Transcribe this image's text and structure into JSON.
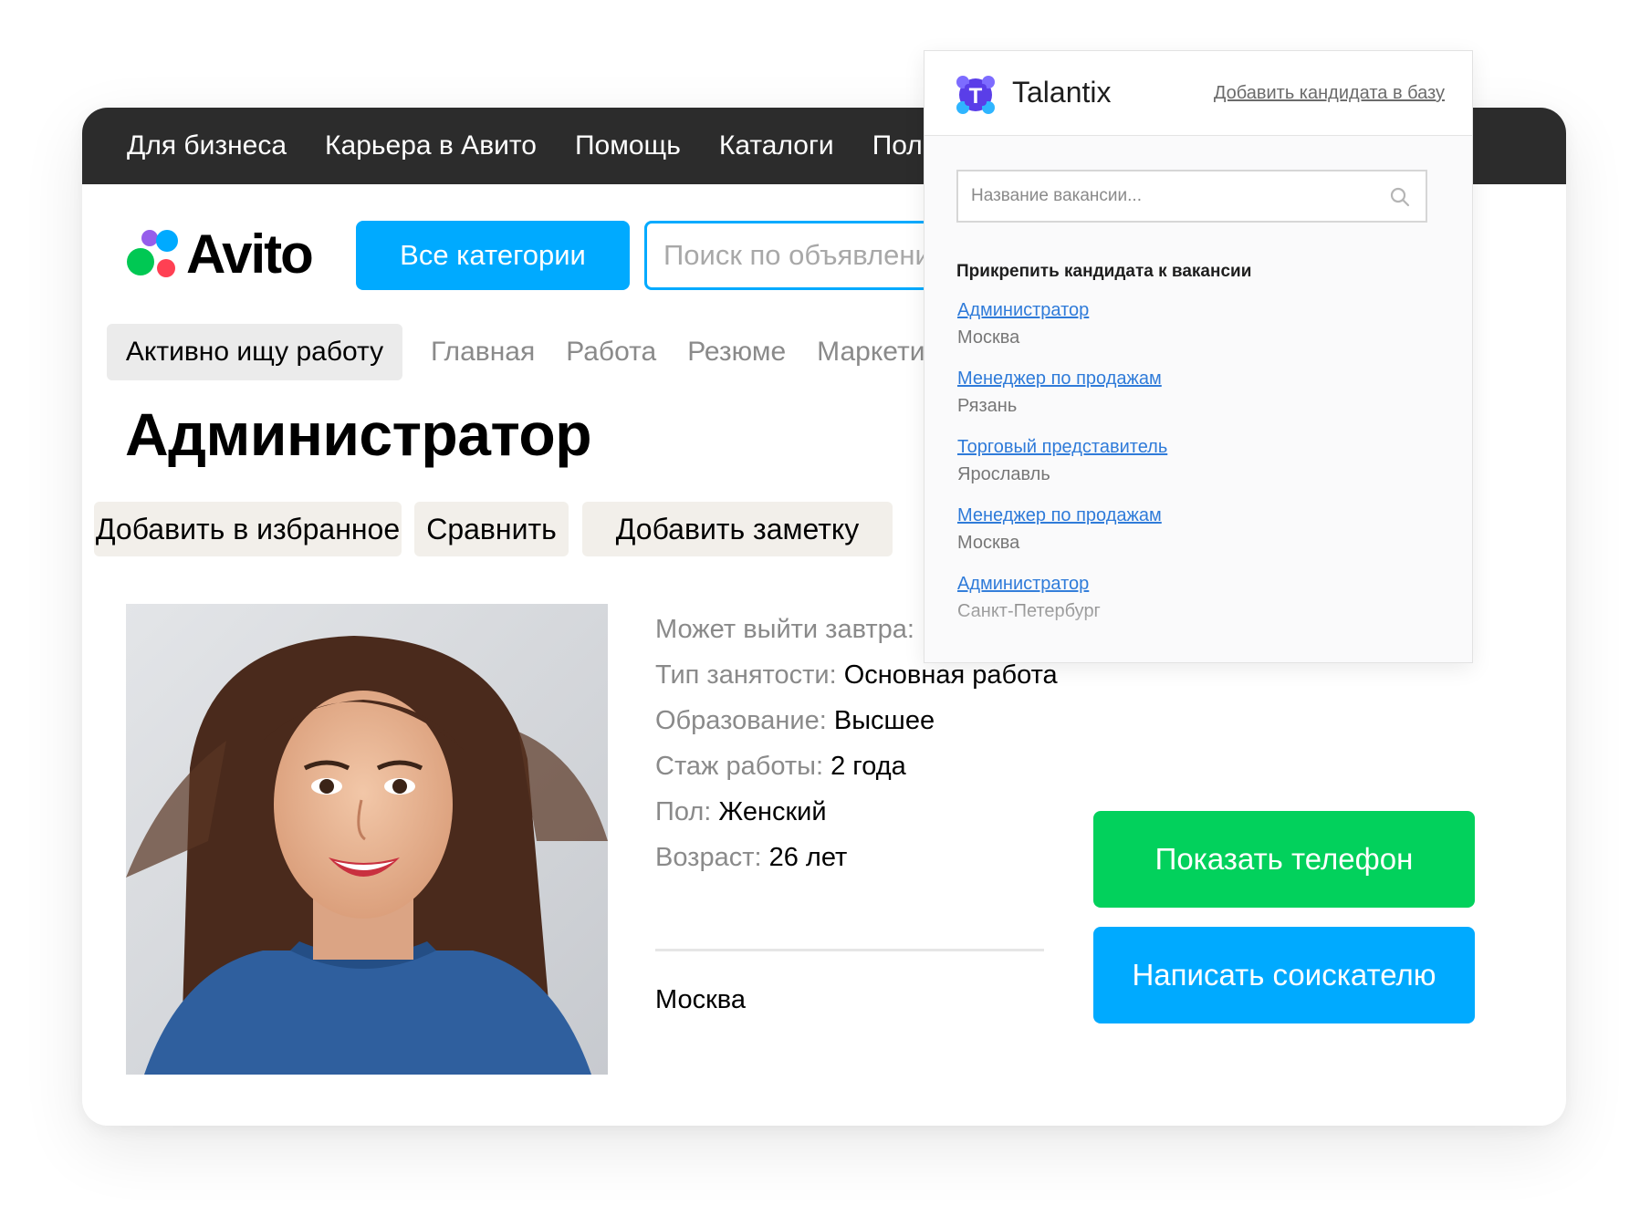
{
  "top_nav": [
    "Для бизнеса",
    "Карьера в Авито",
    "Помощь",
    "Каталоги",
    "Поли"
  ],
  "logo": {
    "text": "Avito",
    "colors": [
      "#00c853",
      "#965eeb",
      "#ff4053",
      "#00aaff"
    ]
  },
  "header": {
    "categories_label": "Все категории",
    "search_placeholder": "Поиск по объявлениям"
  },
  "sub_nav": {
    "active": "Активно ищу работу",
    "items": [
      "Главная",
      "Работа",
      "Резюме",
      "Маркети"
    ]
  },
  "page_title": "Администратор",
  "actions": {
    "favorite": "Добавить в избранное",
    "compare": "Сравнить",
    "note": "Добавить заметку"
  },
  "photo": {
    "icon": "candidate-photo"
  },
  "details": [
    {
      "label": "Может выйти завтра:",
      "value": ""
    },
    {
      "label": "Тип занятости:",
      "value": "Основная работа"
    },
    {
      "label": "Образование:",
      "value": "Высшее"
    },
    {
      "label": "Стаж работы:",
      "value": "2 года"
    },
    {
      "label": "Пол:",
      "value": "Женский"
    },
    {
      "label": "Возраст:",
      "value": "26 лет"
    }
  ],
  "location": "Москва",
  "buttons": {
    "show_phone": "Показать телефон",
    "write": "Написать соискателю"
  },
  "colors": {
    "avito_blue": "#00aaff",
    "avito_green": "#02d15c",
    "nav_dark": "#2c2c2c",
    "talantix_link": "#2f7bd9",
    "talantix_logo": "#5a3ee8"
  },
  "talantix": {
    "brand": "Talantix",
    "logo_letter": "T",
    "add_candidate": "Добавить кандидата в базу",
    "search_placeholder": "Название вакансии...",
    "attach_heading": "Прикрепить кандидата к вакансии",
    "vacancies": [
      {
        "title": "Администратор",
        "city": "Москва"
      },
      {
        "title": "Менеджер по продажам",
        "city": "Рязань"
      },
      {
        "title": "Торговый представитель",
        "city": "Ярославль"
      },
      {
        "title": "Менеджер по продажам",
        "city": "Москва"
      },
      {
        "title": "Администратор",
        "city": "Санкт-Петербург"
      }
    ]
  }
}
